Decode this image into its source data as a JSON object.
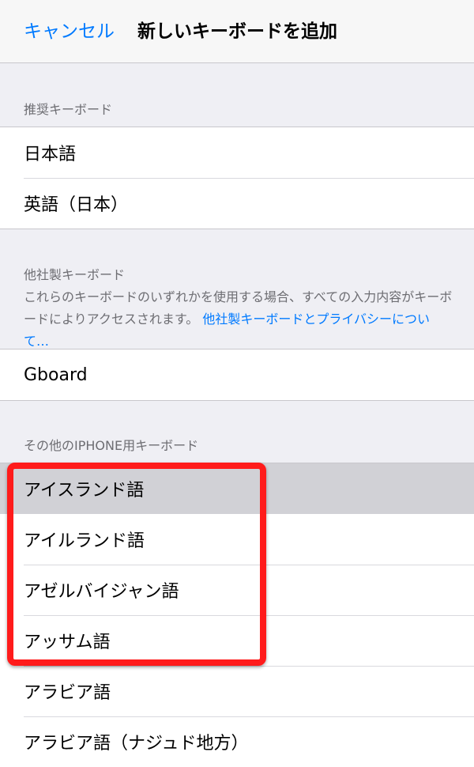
{
  "nav": {
    "cancel_label": "キャンセル",
    "title": "新しいキーボードを追加"
  },
  "suggested": {
    "header": "推奨キーボード",
    "items": [
      "日本語",
      "英語（日本）"
    ]
  },
  "third_party": {
    "header": "他社製キーボード",
    "description": "これらのキーボードのいずれかを使用する場合、すべての入力内容がキーボードによりアクセスされます。",
    "link": "他社製キーボードとプライバシーについて…",
    "items": [
      "Gboard"
    ]
  },
  "other": {
    "header": "その他のIPHONE用キーボード",
    "items": [
      "アイスランド語",
      "アイルランド語",
      "アゼルバイジャン語",
      "アッサム語",
      "アラビア語",
      "アラビア語（ナジュド地方）"
    ]
  },
  "colors": {
    "accent": "#007aff",
    "highlight_box": "#ff1b1b"
  }
}
